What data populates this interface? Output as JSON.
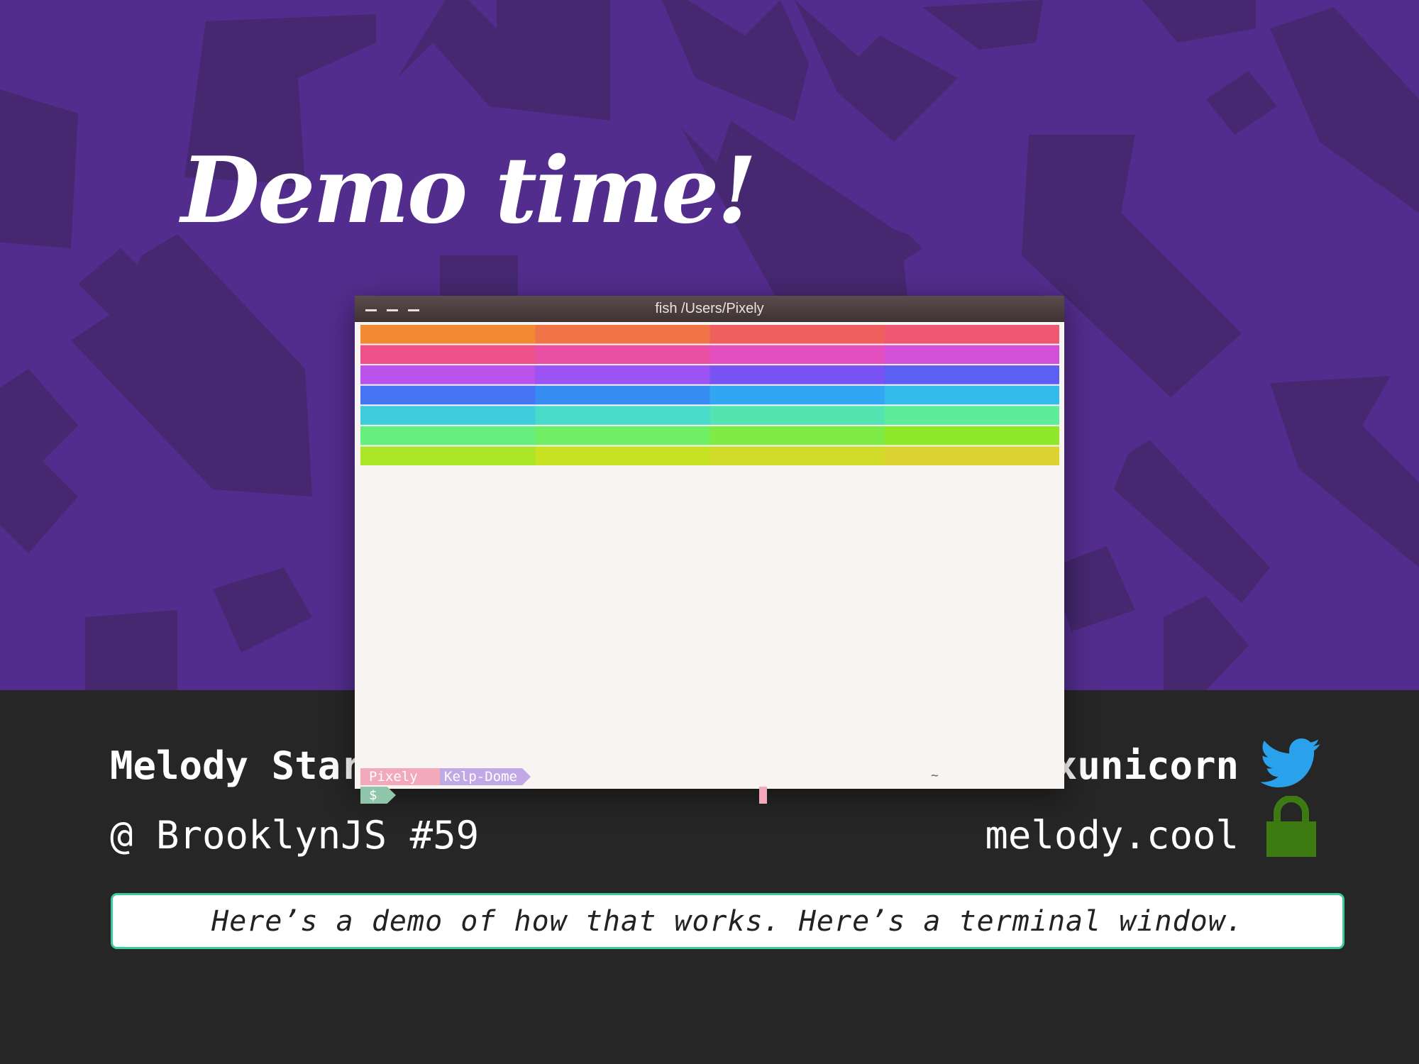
{
  "slide": {
    "title": "Demo time!",
    "background_color": "#532d8d",
    "footer_color": "#262626"
  },
  "terminal": {
    "window_title": "fish /Users/Pixely",
    "window_controls": [
      "minimize",
      "minimize",
      "minimize"
    ],
    "rainbow_colors": [
      "#f28a33",
      "#ef5d60",
      "#ee4f8b",
      "#e24fc6",
      "#b453f3",
      "#6c52f4",
      "#3a7ff3",
      "#2eb3f1",
      "#45d7d4",
      "#5aeb9f",
      "#6df06b",
      "#8ce82c",
      "#c6e424",
      "#dcd230"
    ],
    "prompt": {
      "user": "Pixely",
      "host": "Kelp-Dome",
      "path": "~",
      "symbol": "$"
    },
    "background_color": "#f8f4f2"
  },
  "speaker": {
    "name": "Melody Starling",
    "event": "@ BrooklynJS #59",
    "handle": "@nyxunicorn",
    "website": "melody.cool"
  },
  "icons": {
    "twitter": "twitter-bird-icon",
    "lock": "lock-icon",
    "twitter_color": "#2aa1eb",
    "lock_color": "#3d7a12"
  },
  "caption": {
    "text": "Here’s a demo of how that works. Here’s a terminal window.",
    "border_color": "#3ccaa2"
  }
}
